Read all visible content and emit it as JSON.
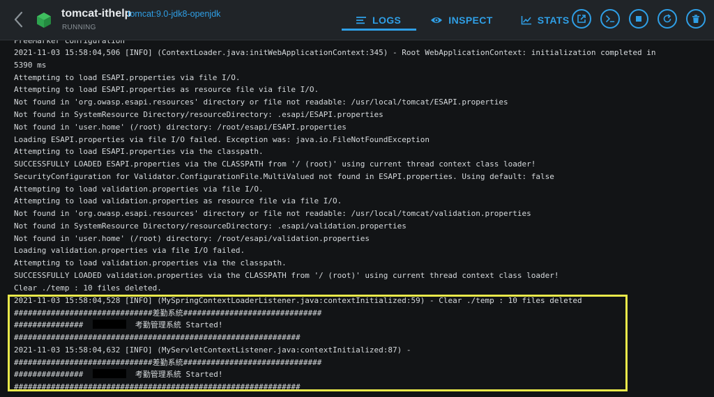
{
  "header": {
    "container_name": "tomcat-ithelp",
    "image": "tomcat:9.0-jdk8-openjdk",
    "status": "RUNNING"
  },
  "tabs": [
    {
      "label": "LOGS",
      "icon": "logs-icon",
      "active": true
    },
    {
      "label": "INSPECT",
      "icon": "eye-icon",
      "active": false
    },
    {
      "label": "STATS",
      "icon": "chart-icon",
      "active": false
    }
  ],
  "actions": [
    {
      "icon": "open-browser-icon",
      "label": "Open in browser"
    },
    {
      "icon": "cli-icon",
      "label": "CLI"
    },
    {
      "icon": "stop-icon",
      "label": "Stop"
    },
    {
      "icon": "restart-icon",
      "label": "Restart"
    },
    {
      "icon": "delete-icon",
      "label": "Delete"
    }
  ],
  "colors": {
    "accent": "#2f9fe6",
    "header_bg": "#202428",
    "log_bg": "#121416",
    "log_text": "#d6dadd",
    "highlight": "#e9e94a",
    "running_icon": "#2ea44f"
  },
  "logs": {
    "lines": [
      "FreeMarker configuration",
      "2021-11-03 15:58:04,506 [INFO] (ContextLoader.java:initWebApplicationContext:345) - Root WebApplicationContext: initialization completed in",
      "5390 ms",
      "Attempting to load ESAPI.properties via file I/O.",
      "Attempting to load ESAPI.properties as resource file via file I/O.",
      "Not found in 'org.owasp.esapi.resources' directory or file not readable: /usr/local/tomcat/ESAPI.properties",
      "Not found in SystemResource Directory/resourceDirectory: .esapi/ESAPI.properties",
      "Not found in 'user.home' (/root) directory: /root/esapi/ESAPI.properties",
      "Loading ESAPI.properties via file I/O failed. Exception was: java.io.FileNotFoundException",
      "Attempting to load ESAPI.properties via the classpath.",
      "SUCCESSFULLY LOADED ESAPI.properties via the CLASSPATH from '/ (root)' using current thread context class loader!",
      "SecurityConfiguration for Validator.ConfigurationFile.MultiValued not found in ESAPI.properties. Using default: false",
      "Attempting to load validation.properties via file I/O.",
      "Attempting to load validation.properties as resource file via file I/O.",
      "Not found in 'org.owasp.esapi.resources' directory or file not readable: /usr/local/tomcat/validation.properties",
      "Not found in SystemResource Directory/resourceDirectory: .esapi/validation.properties",
      "Not found in 'user.home' (/root) directory: /root/esapi/validation.properties",
      "Loading validation.properties via file I/O failed.",
      "Attempting to load validation.properties via the classpath.",
      "SUCCESSFULLY LOADED validation.properties via the CLASSPATH from '/ (root)' using current thread context class loader!",
      "Clear ./temp : 10 files deleted."
    ],
    "highlighted_lines": [
      "2021-11-03 15:58:04,528 [INFO] (MySpringContextLoaderListener.java:contextInitialized:59) - Clear ./temp : 10 files deleted",
      "##############################差勤系統##############################",
      "###############",
      "考勤管理系統 Started!",
      "##############################################################",
      "2021-11-03 15:58:04,632 [INFO] (MyServletContextListener.java:contextInitialized:87) -",
      "##############################差勤系統##############################",
      "###############",
      "考勤管理系統 Started!",
      "##############################################################"
    ]
  }
}
